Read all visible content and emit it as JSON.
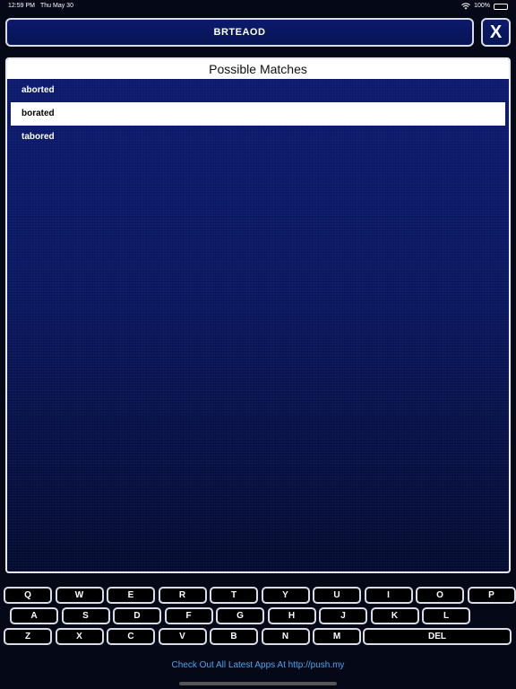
{
  "status_bar": {
    "time": "12:59 PM",
    "date": "Thu May 30",
    "battery": "100%",
    "battery_level": 1.0
  },
  "query": {
    "letters": "BRTEAOD"
  },
  "close_button": {
    "label": "X"
  },
  "results": {
    "header": "Possible Matches",
    "matches": [
      {
        "word": "aborted",
        "selected": false
      },
      {
        "word": "borated",
        "selected": true
      },
      {
        "word": "tabored",
        "selected": false
      }
    ]
  },
  "keyboard": {
    "row1": [
      "Q",
      "W",
      "E",
      "R",
      "T",
      "Y",
      "U",
      "I",
      "O",
      "P"
    ],
    "row2": [
      "A",
      "S",
      "D",
      "F",
      "G",
      "H",
      "J",
      "K",
      "L"
    ],
    "row3": [
      "Z",
      "X",
      "C",
      "V",
      "B",
      "N",
      "M"
    ],
    "delete_label": "DEL"
  },
  "footer": {
    "link_text": "Check Out All Latest Apps At http://push.my"
  },
  "colors": {
    "background": "#040817",
    "panel": "#0b1a6e",
    "link": "#4aa3f0",
    "border": "#d8dde8"
  }
}
